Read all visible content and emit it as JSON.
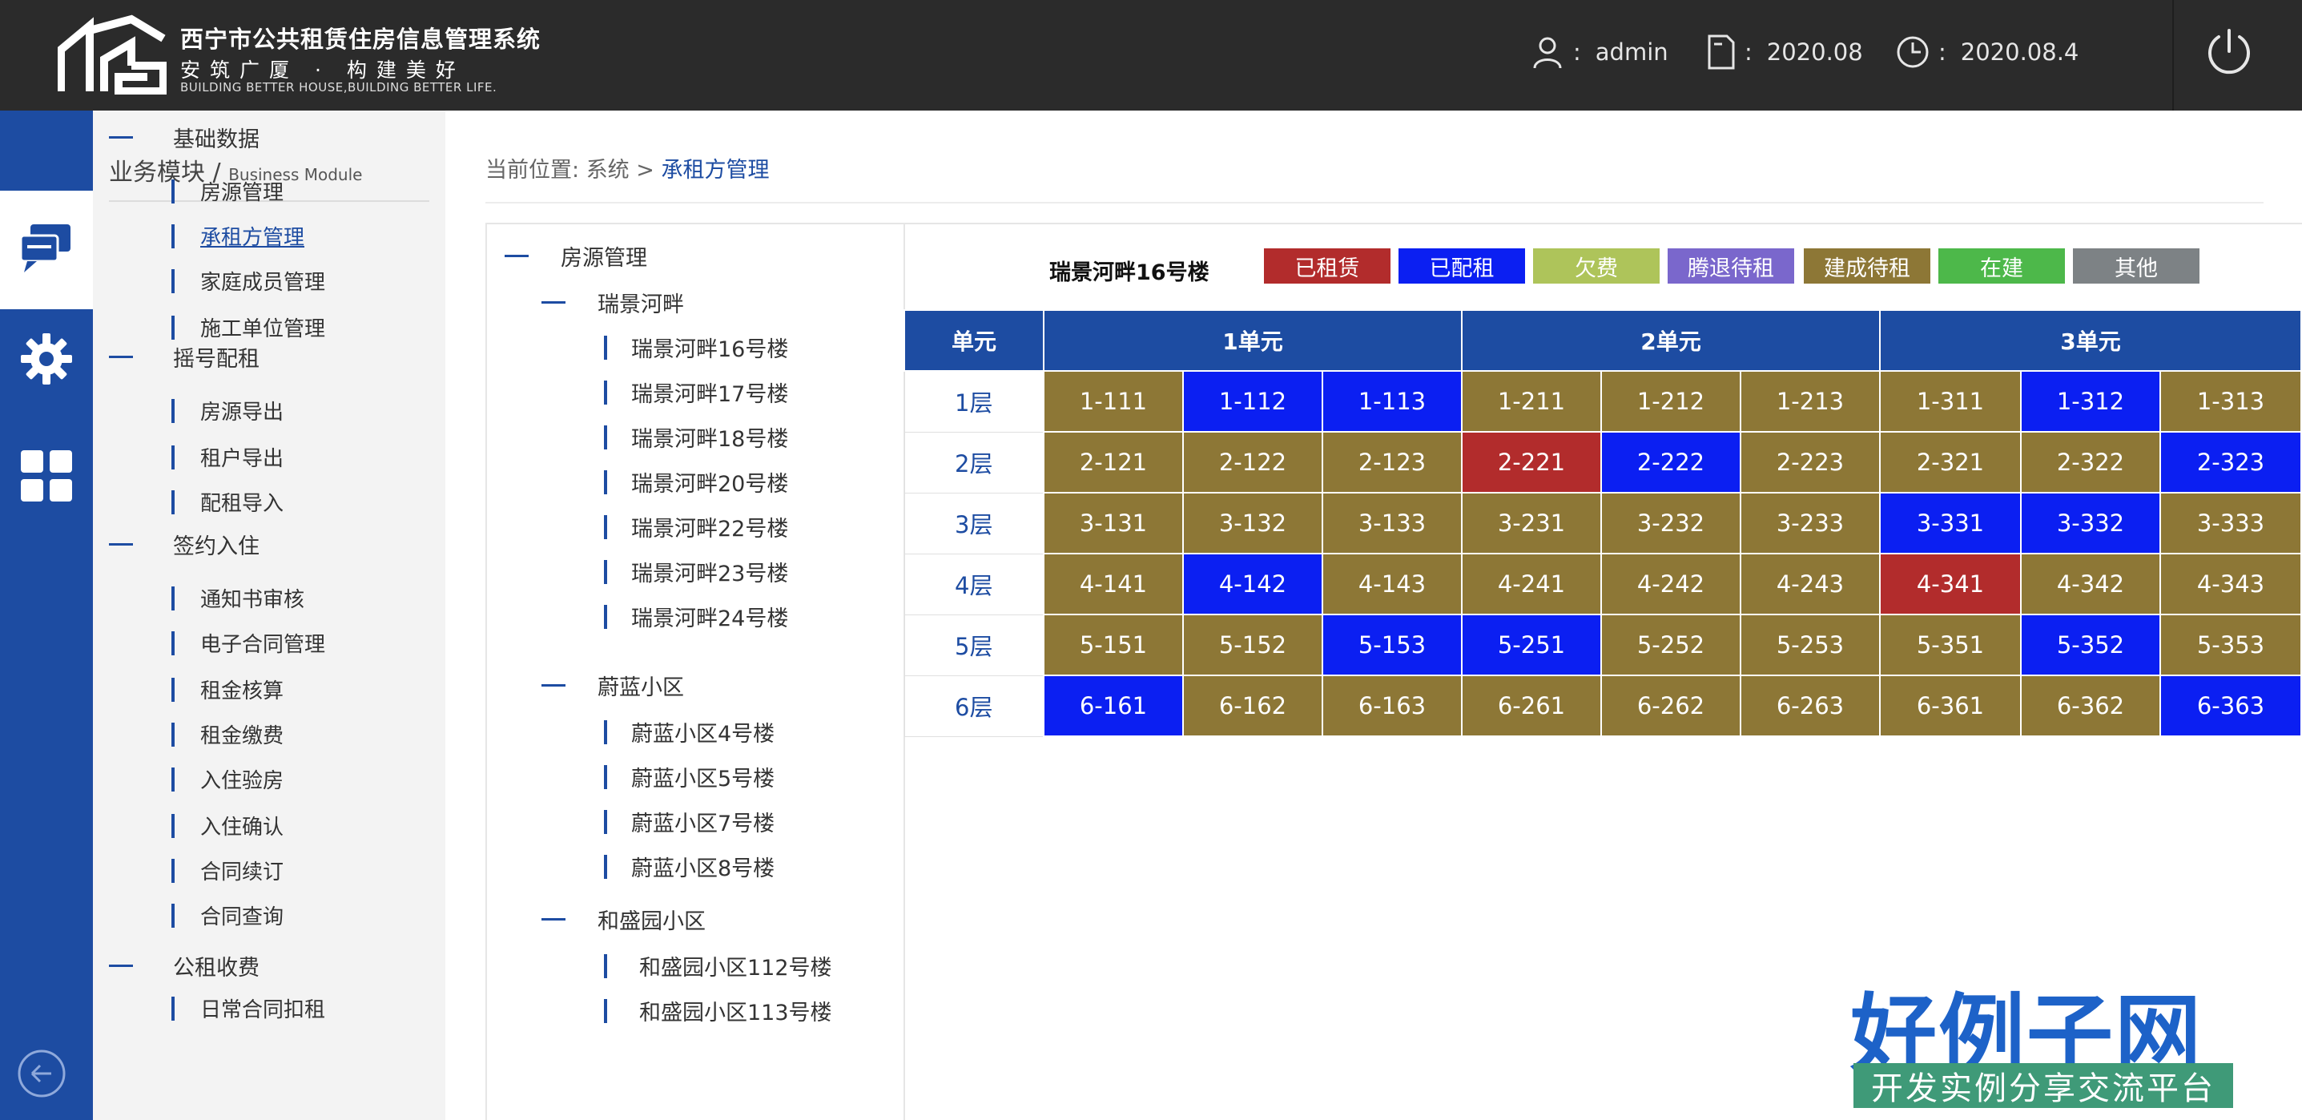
{
  "header": {
    "system_title": "西宁市公共租赁住房信息管理系统",
    "slogan": "安筑广厦 · 构建美好",
    "slogan_en": "BUILDING BETTER HOUSE,BUILDING BETTER LIFE.",
    "user_label": "admin",
    "period_label": "2020.08",
    "date_label": "2020.08.4",
    "sep": ":"
  },
  "menu": {
    "title": "业务模块 / ",
    "title_en": "Business Module",
    "groups": [
      {
        "label": "基础数据",
        "items": [
          "房源管理",
          "承租方管理",
          "家庭成员管理",
          "施工单位管理"
        ]
      },
      {
        "label": "摇号配租",
        "items": [
          "房源导出",
          "租户导出",
          "配租导入"
        ]
      },
      {
        "label": "签约入住",
        "items": [
          "通知书审核",
          "电子合同管理",
          "租金核算",
          "租金缴费",
          "入住验房",
          "入住确认",
          "合同续订",
          "合同查询"
        ]
      },
      {
        "label": "公租收费",
        "items": [
          "日常合同扣租"
        ]
      }
    ]
  },
  "breadcrumb": {
    "prefix": "当前位置: ",
    "system": "系统",
    "arrow": " > ",
    "current": "承租方管理"
  },
  "tree": {
    "root": "房源管理",
    "communities": [
      {
        "name": "瑞景河畔",
        "buildings": [
          "瑞景河畔16号楼",
          "瑞景河畔17号楼",
          "瑞景河畔18号楼",
          "瑞景河畔20号楼",
          "瑞景河畔22号楼",
          "瑞景河畔23号楼",
          "瑞景河畔24号楼"
        ]
      },
      {
        "name": "蔚蓝小区",
        "buildings": [
          "蔚蓝小区4号楼",
          "蔚蓝小区5号楼",
          "蔚蓝小区7号楼",
          "蔚蓝小区8号楼"
        ]
      },
      {
        "name": "和盛园小区",
        "buildings": [
          "和盛园小区112号楼",
          "和盛园小区113号楼"
        ]
      }
    ]
  },
  "grid": {
    "building_name": "瑞景河畔16号楼",
    "legend": [
      {
        "label": "已租赁",
        "color": "#b22c2c"
      },
      {
        "label": "已配租",
        "color": "#0b1ff2"
      },
      {
        "label": "欠费",
        "color": "#aec45a"
      },
      {
        "label": "腾退待租",
        "color": "#7a67cc"
      },
      {
        "label": "建成待租",
        "color": "#8d7736"
      },
      {
        "label": "在建",
        "color": "#4db84a"
      },
      {
        "label": "其他",
        "color": "#7d8285"
      }
    ],
    "col_header_label": "单元",
    "units": [
      "1单元",
      "2单元",
      "3单元"
    ],
    "rows": [
      {
        "floor": "1层",
        "cells": [
          [
            "1-111",
            "建成待租"
          ],
          [
            "1-112",
            "已配租"
          ],
          [
            "1-113",
            "已配租"
          ],
          [
            "1-211",
            "建成待租"
          ],
          [
            "1-212",
            "建成待租"
          ],
          [
            "1-213",
            "建成待租"
          ],
          [
            "1-311",
            "建成待租"
          ],
          [
            "1-312",
            "已配租"
          ],
          [
            "1-313",
            "建成待租"
          ]
        ]
      },
      {
        "floor": "2层",
        "cells": [
          [
            "2-121",
            "建成待租"
          ],
          [
            "2-122",
            "建成待租"
          ],
          [
            "2-123",
            "建成待租"
          ],
          [
            "2-221",
            "已租赁"
          ],
          [
            "2-222",
            "已配租"
          ],
          [
            "2-223",
            "建成待租"
          ],
          [
            "2-321",
            "建成待租"
          ],
          [
            "2-322",
            "建成待租"
          ],
          [
            "2-323",
            "已配租"
          ]
        ]
      },
      {
        "floor": "3层",
        "cells": [
          [
            "3-131",
            "建成待租"
          ],
          [
            "3-132",
            "建成待租"
          ],
          [
            "3-133",
            "建成待租"
          ],
          [
            "3-231",
            "建成待租"
          ],
          [
            "3-232",
            "建成待租"
          ],
          [
            "3-233",
            "建成待租"
          ],
          [
            "3-331",
            "已配租"
          ],
          [
            "3-332",
            "已配租"
          ],
          [
            "3-333",
            "建成待租"
          ]
        ]
      },
      {
        "floor": "4层",
        "cells": [
          [
            "4-141",
            "建成待租"
          ],
          [
            "4-142",
            "已配租"
          ],
          [
            "4-143",
            "建成待租"
          ],
          [
            "4-241",
            "建成待租"
          ],
          [
            "4-242",
            "建成待租"
          ],
          [
            "4-243",
            "建成待租"
          ],
          [
            "4-341",
            "已租赁"
          ],
          [
            "4-342",
            "建成待租"
          ],
          [
            "4-343",
            "建成待租"
          ]
        ]
      },
      {
        "floor": "5层",
        "cells": [
          [
            "5-151",
            "建成待租"
          ],
          [
            "5-152",
            "建成待租"
          ],
          [
            "5-153",
            "已配租"
          ],
          [
            "5-251",
            "已配租"
          ],
          [
            "5-252",
            "建成待租"
          ],
          [
            "5-253",
            "建成待租"
          ],
          [
            "5-351",
            "建成待租"
          ],
          [
            "5-352",
            "已配租"
          ],
          [
            "5-353",
            "建成待租"
          ]
        ]
      },
      {
        "floor": "6层",
        "cells": [
          [
            "6-161",
            "已配租"
          ],
          [
            "6-162",
            "建成待租"
          ],
          [
            "6-163",
            "建成待租"
          ],
          [
            "6-261",
            "建成待租"
          ],
          [
            "6-262",
            "建成待租"
          ],
          [
            "6-263",
            "建成待租"
          ],
          [
            "6-361",
            "建成待租"
          ],
          [
            "6-362",
            "建成待租"
          ],
          [
            "6-363",
            "已配租"
          ]
        ]
      }
    ]
  },
  "watermark": {
    "big": "好例子网",
    "small": "开发实例分享交流平台"
  }
}
